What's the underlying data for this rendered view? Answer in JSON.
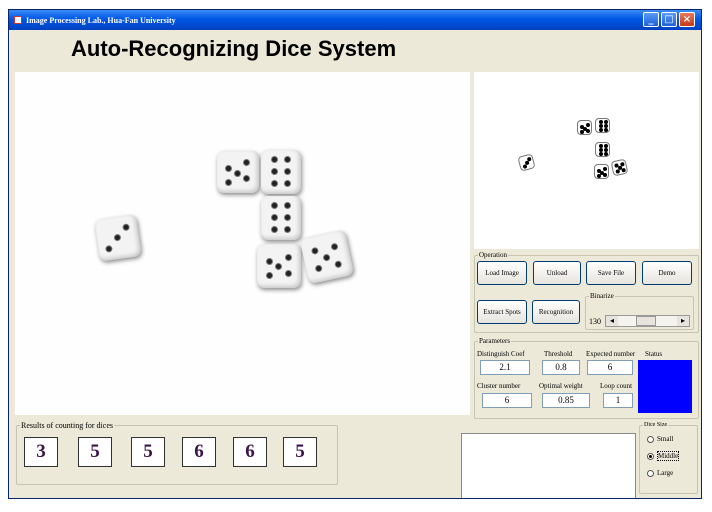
{
  "window": {
    "title": "Image Processing Lab., Hua-Fan University",
    "min": "_",
    "max": "□",
    "close": "×"
  },
  "app_title": "Auto-Recognizing Dice System",
  "operation": {
    "legend": "Operation",
    "load": "Load Image",
    "unload": "Unload",
    "save": "Save File",
    "demo": "Demo",
    "extract": "Extract Spots",
    "recognition": "Recognition",
    "binarize_legend": "Binarize",
    "binarize_value": "130"
  },
  "parameters": {
    "legend": "Parameters",
    "distinguish_label": "Distinguish Coef",
    "distinguish_value": "2.1",
    "threshold_label": "Threshold",
    "threshold_value": "0.8",
    "expected_label": "Expected number",
    "expected_value": "6",
    "status_label": "Status",
    "status_color": "#0000ff",
    "cluster_label": "Cluster number",
    "cluster_value": "6",
    "optimal_label": "Optimal weight",
    "optimal_value": "0.85",
    "loop_label": "Loop count",
    "loop_value": "1"
  },
  "results": {
    "legend": "Results of counting for dices",
    "values": [
      "3",
      "5",
      "5",
      "6",
      "6",
      "5"
    ]
  },
  "dice_size": {
    "legend": "Dice Size",
    "options": [
      "Small",
      "Middle",
      "Large"
    ],
    "selected": "Middle"
  }
}
